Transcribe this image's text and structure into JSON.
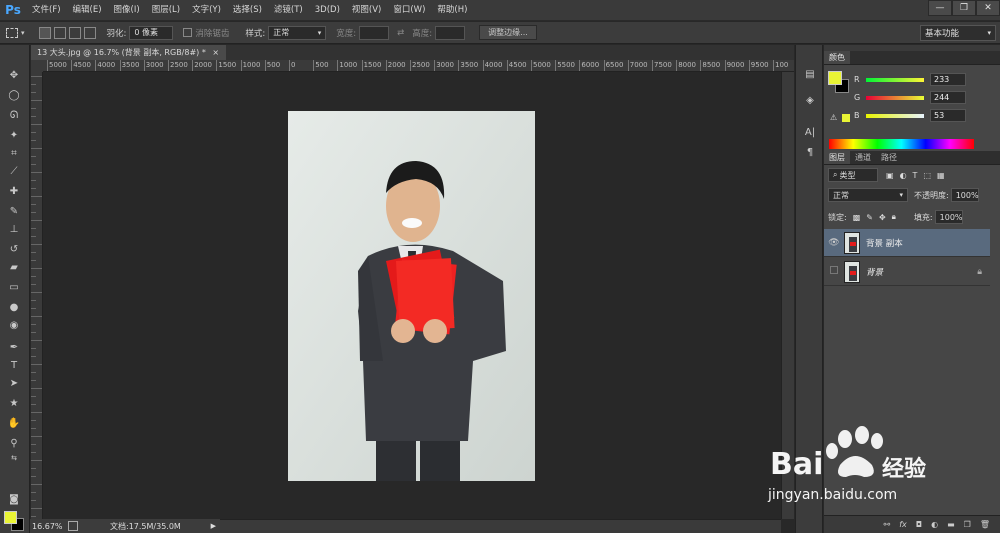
{
  "app": {
    "logo": "Ps",
    "menu": [
      "文件(F)",
      "编辑(E)",
      "图像(I)",
      "图层(L)",
      "文字(Y)",
      "选择(S)",
      "滤镜(T)",
      "3D(D)",
      "视图(V)",
      "窗口(W)",
      "帮助(H)"
    ],
    "window_controls": [
      "—",
      "❐",
      "✕"
    ]
  },
  "options": {
    "feather_label": "羽化:",
    "feather_value": "0 像素",
    "antialias_label": "消除锯齿",
    "style_label": "样式:",
    "style_value": "正常",
    "width_label": "宽度:",
    "height_label": "高度:",
    "refine_button": "调整边缘...",
    "workspace": "基本功能"
  },
  "document": {
    "tab_title": "13 大头.jpg @ 16.7% (背景 副本, RGB/8#) *",
    "zoom": "16.67%",
    "doc_info": "文档:17.5M/35.0M"
  },
  "ruler": {
    "h_labels": [
      "5000",
      "4500",
      "4000",
      "3500",
      "3000",
      "2500",
      "2000",
      "1500",
      "1000",
      "500",
      "0",
      "500",
      "1000",
      "1500",
      "2000",
      "2500",
      "3000",
      "3500",
      "4000",
      "4500",
      "5000",
      "5500",
      "6000",
      "6500",
      "7000",
      "7500",
      "8000",
      "8500",
      "9000",
      "9500",
      "100"
    ]
  },
  "color_panel": {
    "tab": "颜色",
    "r_label": "R",
    "r_value": "233",
    "g_label": "G",
    "g_value": "244",
    "b_label": "B",
    "b_value": "53",
    "fg_color": "#e9f435",
    "bg_color": "#000000"
  },
  "layers_panel": {
    "tabs": [
      "图层",
      "通道",
      "路径"
    ],
    "filter": "类型",
    "blend_mode": "正常",
    "opacity_label": "不透明度:",
    "opacity_value": "100%",
    "lock_label": "锁定:",
    "fill_label": "填充:",
    "fill_value": "100%",
    "layers": [
      {
        "name": "背景 副本",
        "visible": true,
        "selected": true
      },
      {
        "name": "背景",
        "visible": false,
        "selected": false
      }
    ],
    "bottom_icons": [
      "link-icon",
      "fx-icon",
      "mask-icon",
      "adjustment-icon",
      "folder-icon",
      "new-layer-icon",
      "trash-icon"
    ]
  },
  "watermark": {
    "brand": "Bai",
    "brand2": "经验",
    "url": "jingyan.baidu.com"
  }
}
